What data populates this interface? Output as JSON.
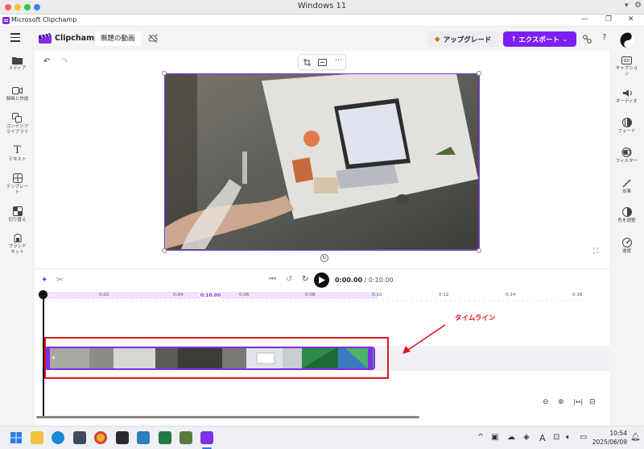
{
  "mac_window": {
    "title": "Windows 11"
  },
  "app_titlebar": {
    "title": "Microsoft Clipchamp",
    "min": "—",
    "restore": "❐",
    "close": "✕"
  },
  "header": {
    "app_name": "Clipchamp",
    "project_name": "無題の動画",
    "upgrade_label": "アップグレード",
    "export_label": "エクスポート",
    "help_label": "?"
  },
  "left_rail": [
    {
      "label": "メディア",
      "icon": "folder-icon"
    },
    {
      "label": "録画と作成",
      "icon": "camera-icon"
    },
    {
      "label": "コンテンツ\nライブラリ",
      "icon": "library-icon"
    },
    {
      "label": "テキスト",
      "icon": "text-icon"
    },
    {
      "label": "テンプレー\nト",
      "icon": "templates-icon"
    },
    {
      "label": "切り替え",
      "icon": "transitions-icon"
    },
    {
      "label": "ブランド\nキット",
      "icon": "brand-kit-icon"
    }
  ],
  "right_rail": [
    {
      "label": "キャプショ\nン",
      "icon": "captions-icon"
    },
    {
      "label": "オーディオ",
      "icon": "audio-icon"
    },
    {
      "label": "フェード",
      "icon": "fade-icon"
    },
    {
      "label": "フィルター",
      "icon": "filter-icon"
    },
    {
      "label": "効果",
      "icon": "effects-icon"
    },
    {
      "label": "色を調整",
      "icon": "color-adjust-icon"
    },
    {
      "label": "速度",
      "icon": "speed-icon"
    }
  ],
  "playback": {
    "current_time": "0:00.00",
    "total_time": "/ 0:10.00"
  },
  "ruler": {
    "ticks": [
      "0:02",
      "0:04",
      "0:06",
      "0:08",
      "0:10",
      "0:12",
      "0:14",
      "0:16"
    ],
    "highlight": "0:10.00"
  },
  "annotation": {
    "label": "タイムライン",
    "color": "#e0151e"
  },
  "colors": {
    "accent": "#7e2fe7",
    "export": "#7d1ff0"
  },
  "taskbar": {
    "time": "10:54",
    "date": "2025/06/09",
    "ime": "A"
  }
}
